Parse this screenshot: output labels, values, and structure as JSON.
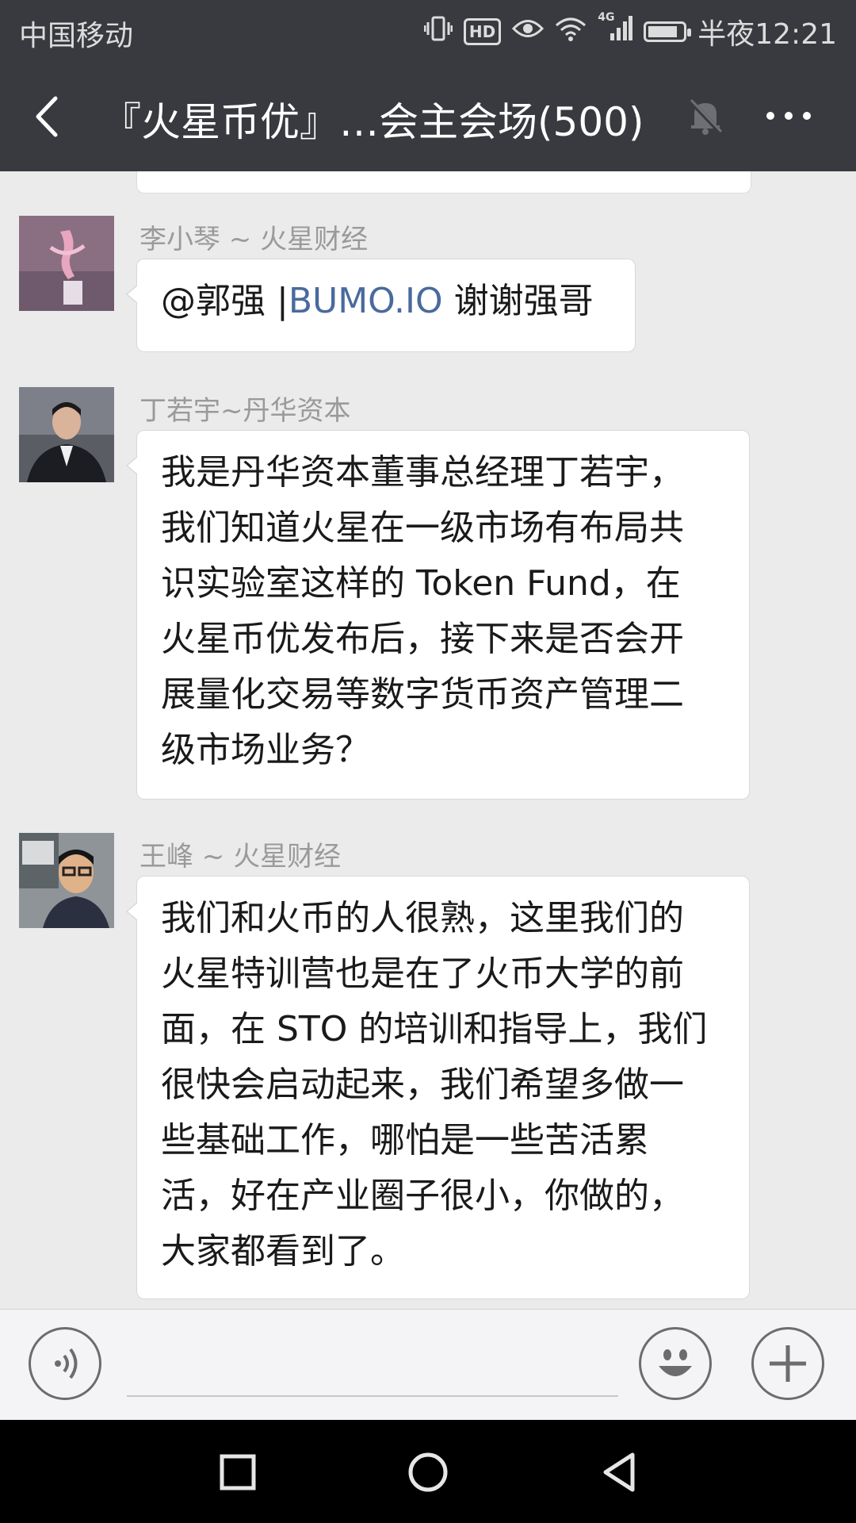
{
  "status_bar": {
    "carrier": "中国移动",
    "network": "4G",
    "hd": "HD",
    "time": "半夜12:21",
    "battery_level": 0.85
  },
  "header": {
    "title": "『火星币优』…会主会场(500)",
    "back_icon": "chevron-left-icon",
    "mute_icon": "bell-off-icon",
    "more_icon": "more-horizontal-icon"
  },
  "messages": [
    {
      "sender": "李小琴 ~ 火星财经",
      "mention": "@郭强 |",
      "link": "BUMO.IO",
      "text": " 谢谢强哥"
    },
    {
      "sender": "丁若宇~丹华资本",
      "lines": [
        "我是丹华资本董事总经理丁若宇，",
        "我们知道火星在一级市场有布局共",
        "识实验室这样的 Token Fund，在",
        "火星币优发布后，接下来是否会开",
        "展量化交易等数字货币资产管理二",
        "级市场业务？"
      ]
    },
    {
      "sender": "王峰 ~ 火星财经",
      "lines": [
        "我们和火币的人很熟，这里我们的",
        "火星特训营也是在了火币大学的前",
        "面，在 STO 的培训和指导上，我们",
        "很快会启动起来，我们希望多做一",
        "些基础工作，哪怕是一些苦活累",
        "活，好在产业圈子很小，你做的，",
        "大家都看到了。"
      ]
    }
  ],
  "input_bar": {
    "voice_icon": "voice-icon",
    "emoji_icon": "emoji-icon",
    "plus_icon": "plus-icon"
  },
  "system_nav": {
    "recent_icon": "square-icon",
    "home_icon": "circle-icon",
    "back_icon": "triangle-back-icon"
  },
  "colors": {
    "header_bg": "#393a3f",
    "chat_bg": "#ebebeb",
    "link": "#4a6a9e"
  }
}
